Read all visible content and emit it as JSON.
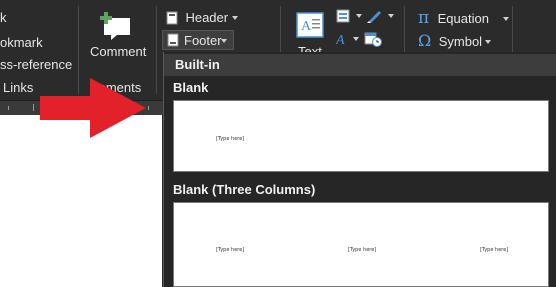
{
  "ribbon": {
    "links_group": {
      "bookmark": "okmark",
      "cross_reference": "ss-reference",
      "group_label": "Links",
      "first_item": "k"
    },
    "comments_group": {
      "comment_label": "Comment",
      "group_label": "mments"
    },
    "header_footer_group": {
      "header_label": "Header",
      "footer_label": "Footer"
    },
    "text_group": {
      "text_label": "Text"
    },
    "symbols_group": {
      "equation_label": "Equation",
      "symbol_label": "Symbol"
    }
  },
  "footer_menu": {
    "section_header": "Built-in",
    "items": [
      {
        "name": "Blank",
        "placeholders": [
          "[Type here]"
        ]
      },
      {
        "name": "Blank (Three Columns)",
        "placeholders": [
          "[Type here]",
          "[Type here]",
          "[Type here]"
        ]
      }
    ]
  },
  "colors": {
    "ribbon_bg": "#2b2b2b",
    "menu_header_bg": "#3d3d3d",
    "accent_blue": "#4a90d9",
    "arrow_red": "#e3212a"
  }
}
